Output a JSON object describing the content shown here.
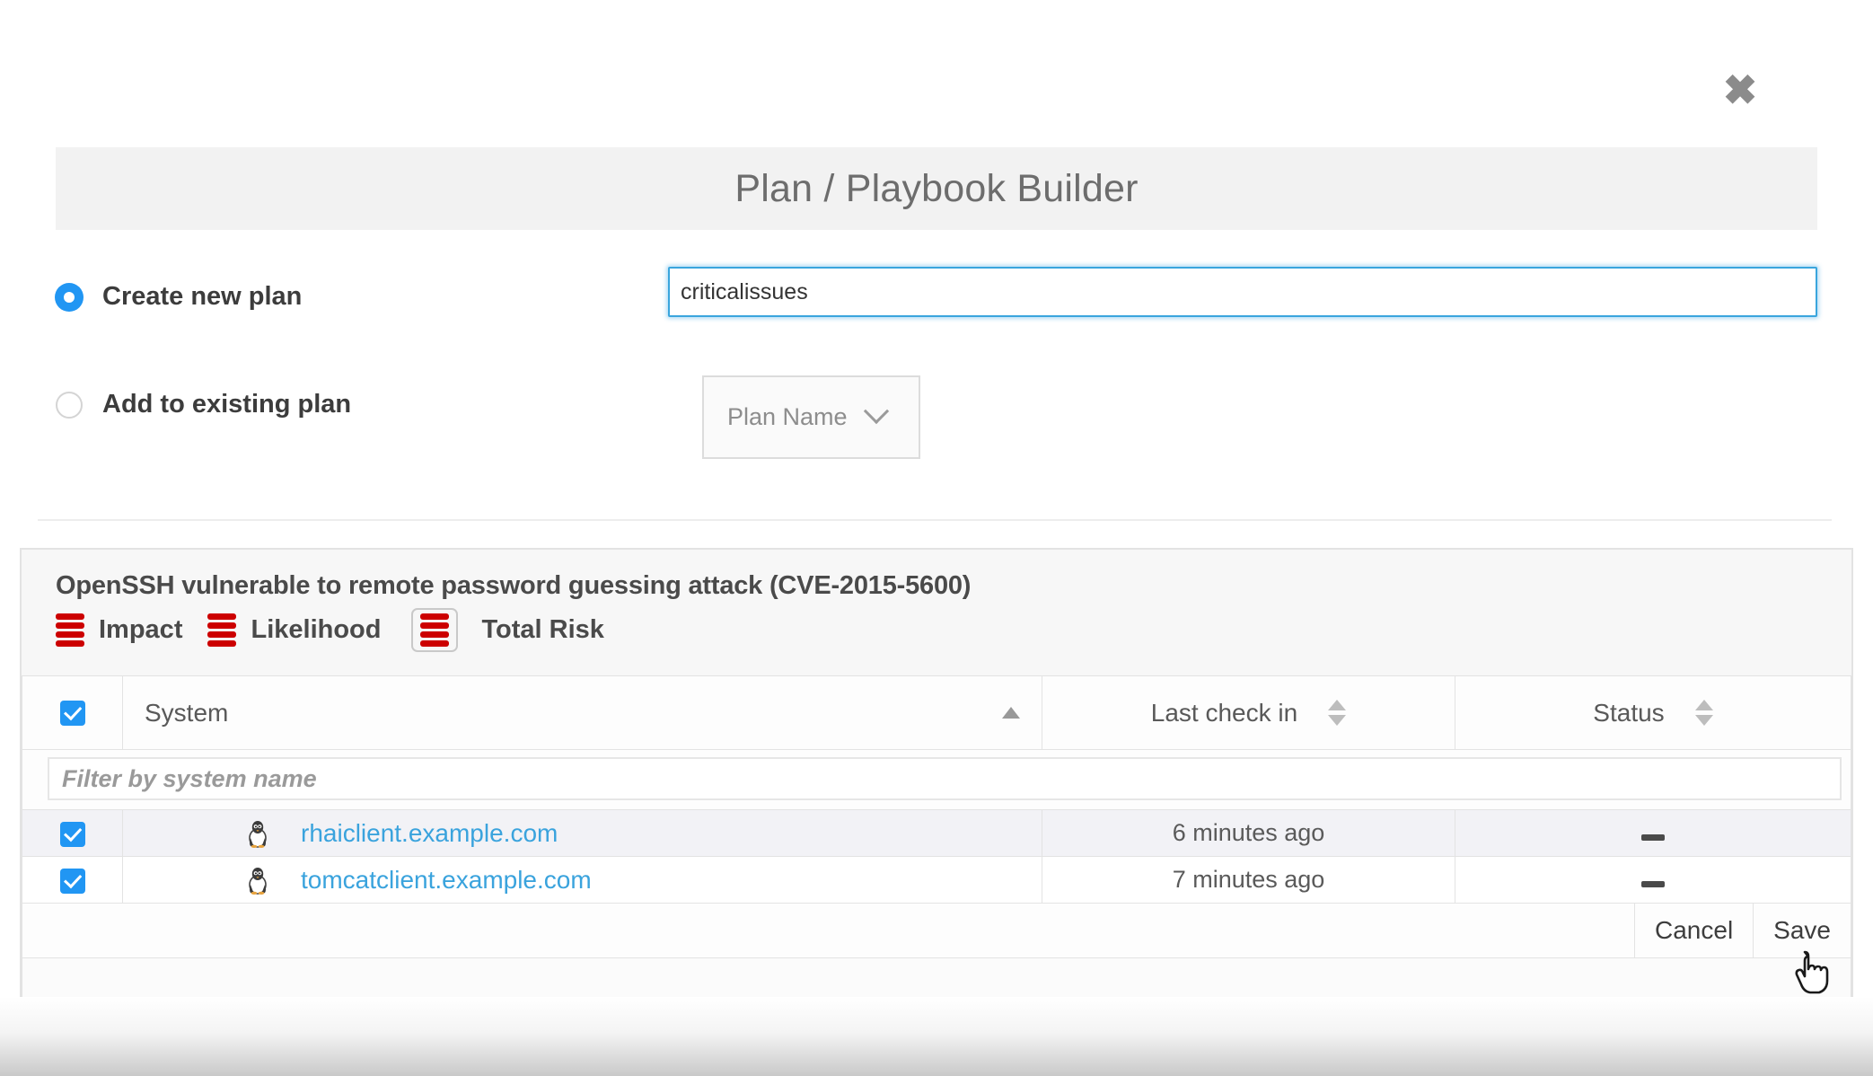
{
  "modal": {
    "title": "Plan / Playbook Builder",
    "close_icon": "close-icon"
  },
  "options": {
    "create_new": {
      "label": "Create new plan",
      "selected": true
    },
    "add_existing": {
      "label": "Add to existing plan",
      "selected": false
    }
  },
  "plan_name_input": {
    "value": "criticalissues",
    "placeholder": "Plan name"
  },
  "plan_select": {
    "label": "Plan Name",
    "chevron_icon": "chevron-down-icon"
  },
  "vulnerability": {
    "title": "OpenSSH vulnerable to remote password guessing attack (CVE-2015-5600)",
    "risks": [
      {
        "name": "Impact",
        "level": 4,
        "boxed": false
      },
      {
        "name": "Likelihood",
        "level": 4,
        "boxed": false
      },
      {
        "name": "Total Risk",
        "level": 4,
        "boxed": true
      }
    ],
    "risk_color": "#cc0000"
  },
  "table": {
    "select_all_checked": true,
    "columns": [
      {
        "key": "system",
        "label": "System",
        "sort": "asc"
      },
      {
        "key": "last_check_in",
        "label": "Last check in",
        "sort": "none"
      },
      {
        "key": "status",
        "label": "Status",
        "sort": "none"
      }
    ],
    "filter": {
      "placeholder": "Filter by system name",
      "value": ""
    },
    "rows": [
      {
        "checked": true,
        "os_icon": "linux-tux-icon",
        "system": "rhaiclient.example.com",
        "last_check_in": "6 minutes ago",
        "status": "—"
      },
      {
        "checked": true,
        "os_icon": "linux-tux-icon",
        "system": "tomcatclient.example.com",
        "last_check_in": "7 minutes ago",
        "status": "—"
      }
    ]
  },
  "actions": {
    "cancel_label": "Cancel",
    "save_label": "Save"
  },
  "colors": {
    "accent_blue": "#2196f3",
    "link_blue": "#3aa3dd",
    "risk_red": "#cc0000",
    "header_gray": "#f2f2f2"
  }
}
